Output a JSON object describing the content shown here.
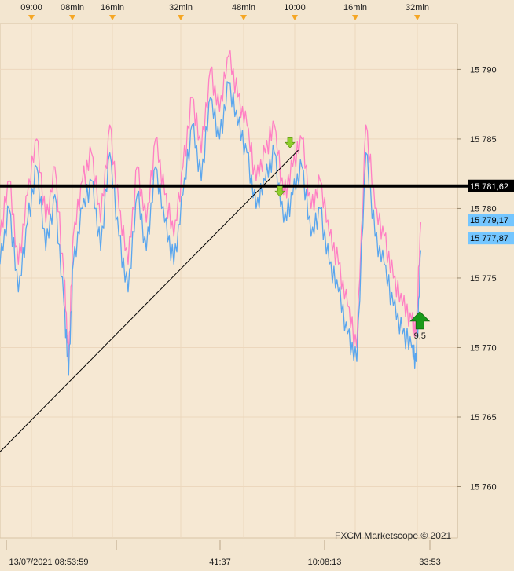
{
  "chart_data": {
    "type": "line",
    "title": "",
    "watermark": "FXCM Marketscope © 2021",
    "y_axis": {
      "ticks": [
        "15 790",
        "15 785",
        "15 780",
        "15 775",
        "15 770",
        "15 765",
        "15 760"
      ],
      "tick_values": [
        15790,
        15785,
        15780,
        15775,
        15770,
        15765,
        15760
      ],
      "ylim": [
        15756.3,
        15793.3
      ]
    },
    "top_time_labels": [
      "09:00",
      "08min",
      "16min",
      "32min",
      "48min",
      "10:00",
      "16min",
      "32min"
    ],
    "bottom_time_labels": [
      "13/07/2021 08:53:59",
      "41:37",
      "10:08:13",
      "33:53"
    ],
    "price_tags": {
      "horizontal_level": "15 781,62",
      "ask": "15 779,17",
      "bid": "15 777,87"
    },
    "levels": {
      "horizontal_line": 15781.62,
      "ask": 15779.17,
      "bid": 15777.87
    },
    "trendline": {
      "from": [
        0.0,
        15762.5
      ],
      "to": [
        0.652,
        15784.2
      ]
    },
    "markers": [
      {
        "kind": "sell",
        "x": 0.634,
        "y": 15784.7
      },
      {
        "kind": "sell",
        "x": 0.612,
        "y": 15781.2
      },
      {
        "kind": "buy",
        "x": 0.918,
        "y": 15771.9,
        "label": "9,5"
      }
    ],
    "series": [
      {
        "color": "#ff7fc4",
        "x": [
          0.0,
          0.02,
          0.04,
          0.06,
          0.08,
          0.1,
          0.12,
          0.14,
          0.15,
          0.16,
          0.18,
          0.2,
          0.22,
          0.24,
          0.26,
          0.28,
          0.3,
          0.32,
          0.34,
          0.36,
          0.38,
          0.4,
          0.42,
          0.44,
          0.46,
          0.48,
          0.5,
          0.52,
          0.54,
          0.56,
          0.58,
          0.6,
          0.62,
          0.64,
          0.66,
          0.68,
          0.7,
          0.72,
          0.74,
          0.76,
          0.78,
          0.8,
          0.82,
          0.84,
          0.86,
          0.88,
          0.9,
          0.91,
          0.92
        ],
        "values": [
          15778,
          15782,
          15776,
          15781,
          15785,
          15779,
          15783,
          15775,
          15769,
          15778,
          15782,
          15784,
          15779,
          15786,
          15780,
          15776,
          15783,
          15779,
          15785,
          15781,
          15778,
          15783,
          15788,
          15784,
          15790,
          15787,
          15791,
          15788,
          15786,
          15782,
          15784,
          15786,
          15781,
          15783,
          15785,
          15780,
          15782,
          15778,
          15776,
          15773,
          15770,
          15786,
          15780,
          15778,
          15775,
          15773,
          15772,
          15771,
          15779
        ]
      },
      {
        "color": "#5aa6ee",
        "x": [
          0.0,
          0.02,
          0.04,
          0.06,
          0.08,
          0.1,
          0.12,
          0.14,
          0.15,
          0.16,
          0.18,
          0.2,
          0.22,
          0.24,
          0.26,
          0.28,
          0.3,
          0.32,
          0.34,
          0.36,
          0.38,
          0.4,
          0.42,
          0.44,
          0.46,
          0.48,
          0.5,
          0.52,
          0.54,
          0.56,
          0.58,
          0.6,
          0.62,
          0.64,
          0.66,
          0.68,
          0.7,
          0.72,
          0.74,
          0.76,
          0.78,
          0.8,
          0.82,
          0.84,
          0.86,
          0.88,
          0.9,
          0.91,
          0.92
        ],
        "values": [
          15776,
          15780,
          15774,
          15779,
          15783,
          15777,
          15781,
          15773,
          15768,
          15776,
          15780,
          15782,
          15777,
          15784,
          15778,
          15774,
          15781,
          15777,
          15783,
          15779,
          15776,
          15781,
          15786,
          15782,
          15788,
          15785,
          15789,
          15786,
          15784,
          15780,
          15782,
          15784,
          15779,
          15781,
          15783,
          15778,
          15780,
          15776,
          15774,
          15771,
          15769,
          15784,
          15778,
          15776,
          15773,
          15771,
          15770,
          15769,
          15777
        ]
      }
    ],
    "grid": true
  },
  "colors": {
    "background": "#f3e6d0",
    "plot_background": "#f6e8d3",
    "grid": "#ecd7bd",
    "axis_marker": "#f5a623",
    "level_line": "#000000",
    "ask_tag": "#74c6ff",
    "bid_tag": "#74c6ff",
    "sell_arrow": "#8fcf2a",
    "buy_arrow": "#1a9a1a"
  }
}
